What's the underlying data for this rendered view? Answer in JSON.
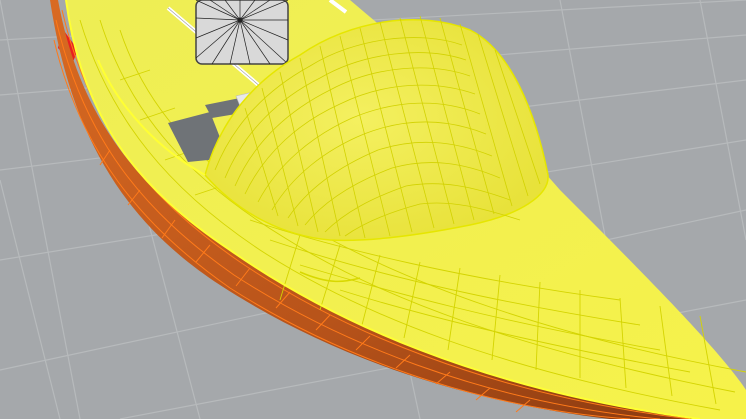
{
  "viewport": {
    "background_color": "#a5a8ab",
    "grid_line_color": "#b7babc",
    "grid_visible": true
  },
  "model": {
    "hull_surface_color": "#f2f047",
    "wireframe_color": "#e6e600",
    "hull_side_color": "#c85f1f",
    "side_edge_color": "#ff7a1a",
    "rudder_color": "#e82020",
    "deck_hatch_color": "#6f7377",
    "mast_color": "#ffffff",
    "hatch_icon": "starburst-hatch-icon"
  }
}
